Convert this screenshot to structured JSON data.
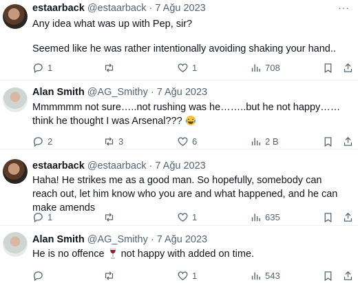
{
  "tweets": [
    {
      "name": "estaarback",
      "handle": "@estaarback",
      "sep": " · ",
      "date": "7 Ağu 2023",
      "avatar": "dark",
      "lines": [
        "Any idea what was up with Pep, sir?",
        "Seemed like he was rather intentionally avoiding shaking your hand.."
      ],
      "emoji": "",
      "replies": "1",
      "retweets": "",
      "likes": "1",
      "views": "708"
    },
    {
      "name": "Alan Smith",
      "handle": "@AG_Smithy",
      "sep": " · ",
      "date": "7 Ağu 2023",
      "avatar": "light",
      "lines": [
        "Mmmmmm not sure…..not rushing was he……..but he not happy……think he thought I was Arsenal???"
      ],
      "emoji": "laughing-tears",
      "replies": "2",
      "retweets": "3",
      "likes": "6",
      "views": "2 B"
    },
    {
      "name": "estaarback",
      "handle": "@estaarback",
      "sep": " · ",
      "date": "7 Ağu 2023",
      "avatar": "dark",
      "lines": [
        "Haha! He strikes me as a good man. So hopefully, somebody can reach out, let him know who you are and what happened, and he can make amends"
      ],
      "emoji": "",
      "replies": "1",
      "retweets": "",
      "likes": "1",
      "views": "635"
    },
    {
      "name": "Alan Smith",
      "handle": "@AG_Smithy",
      "sep": " · ",
      "date": "7 Ağu 2023",
      "avatar": "light",
      "lines": [
        "He is no offence",
        "not happy with added on time."
      ],
      "emoji": "wine-glass",
      "replies": "",
      "retweets": "",
      "likes": "1",
      "views": "543"
    }
  ],
  "more_label": "···",
  "colors": {
    "text": "#0f1419",
    "muted": "#536471",
    "divider": "#eff3f4"
  }
}
